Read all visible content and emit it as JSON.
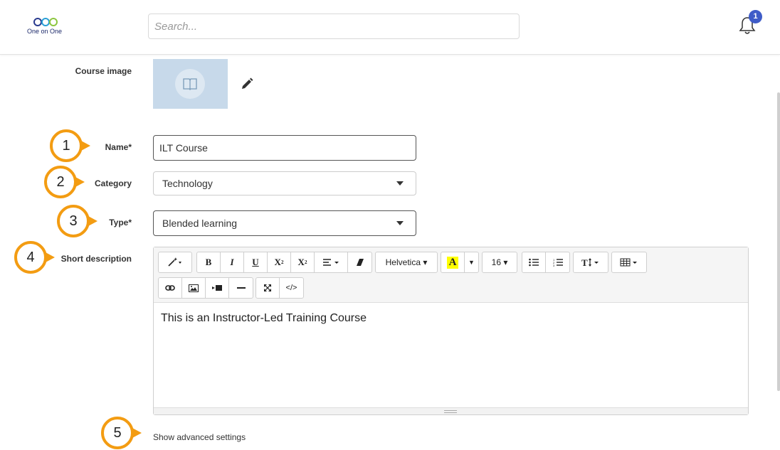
{
  "header": {
    "logo_text": "One on One",
    "search_placeholder": "Search...",
    "notifications_count": "1"
  },
  "form": {
    "course_image_label": "Course image",
    "name_label": "Name*",
    "name_value": "ILT Course",
    "category_label": "Category",
    "category_value": "Technology",
    "type_label": "Type*",
    "type_value": "Blended learning",
    "description_label": "Short description",
    "description_value": "This is an Instructor-Led Training Course",
    "advanced_link": "Show advanced settings"
  },
  "toolbar": {
    "font_name": "Helvetica",
    "font_size": "16",
    "bold": "B",
    "italic": "I",
    "underline": "U",
    "superscript": "X",
    "subscript": "X",
    "highlight": "A",
    "code": "</>"
  },
  "callouts": [
    "1",
    "2",
    "3",
    "4",
    "5"
  ],
  "colors": {
    "callout": "#f39c12",
    "badge": "#3f5cc8",
    "image_bg": "#c7d9ea"
  }
}
